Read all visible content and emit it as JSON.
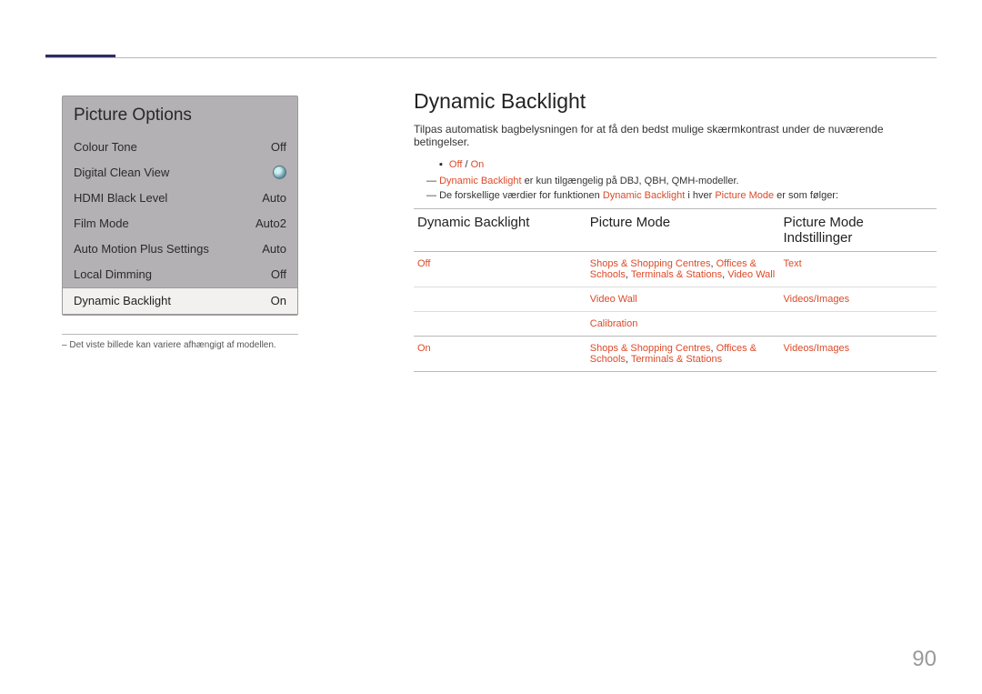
{
  "panel": {
    "title": "Picture Options",
    "rows": [
      {
        "label": "Colour Tone",
        "value": "Off",
        "toggle": false,
        "selected": false
      },
      {
        "label": "Digital Clean View",
        "value": "",
        "toggle": true,
        "selected": false
      },
      {
        "label": "HDMI Black Level",
        "value": "Auto",
        "toggle": false,
        "selected": false
      },
      {
        "label": "Film Mode",
        "value": "Auto2",
        "toggle": false,
        "selected": false
      },
      {
        "label": "Auto Motion Plus Settings",
        "value": "Auto",
        "toggle": false,
        "selected": false
      },
      {
        "label": "Local Dimming",
        "value": "Off",
        "toggle": false,
        "selected": false
      },
      {
        "label": "Dynamic Backlight",
        "value": "On",
        "toggle": false,
        "selected": true
      }
    ]
  },
  "left_note": "Det viste billede kan variere afhængigt af modellen.",
  "section_title": "Dynamic Backlight",
  "intro": "Tilpas automatisk bagbelysningen for at få den bedst mulige skærmkontrast under de nuværende betingelser.",
  "bullet_off": "Off",
  "bullet_sep": " / ",
  "bullet_on": "On",
  "note1_hl": "Dynamic Backlight",
  "note1_rest": " er kun tilgængelig på DBJ, QBH, QMH-modeller.",
  "note2_a": "De forskellige værdier for funktionen ",
  "note2_b": "Dynamic Backlight",
  "note2_c": " i hver ",
  "note2_d": "Picture Mode",
  "note2_e": " er som følger:",
  "table": {
    "headers": [
      "Dynamic Backlight",
      "Picture Mode",
      "Picture Mode Indstillinger"
    ],
    "rows": [
      {
        "c1": "Off",
        "c2": "Shops & Shopping Centres",
        "c2b": "Offices & Schools",
        "c2c": "Terminals & Stations",
        "c2d": "Video Wall",
        "c3": "Text",
        "group_end": false
      },
      {
        "c1": "",
        "c2": "Video Wall",
        "c2b": "",
        "c2c": "",
        "c2d": "",
        "c3": "Videos/Images",
        "group_end": false
      },
      {
        "c1": "",
        "c2": "Calibration",
        "c2b": "",
        "c2c": "",
        "c2d": "",
        "c3": "",
        "group_end": true
      },
      {
        "c1": "On",
        "c2": "Shops & Shopping Centres",
        "c2b": "Offices & Schools",
        "c2c": "Terminals & Stations",
        "c2d": "",
        "c3": "Videos/Images",
        "group_end": true
      }
    ]
  },
  "page_number": "90"
}
